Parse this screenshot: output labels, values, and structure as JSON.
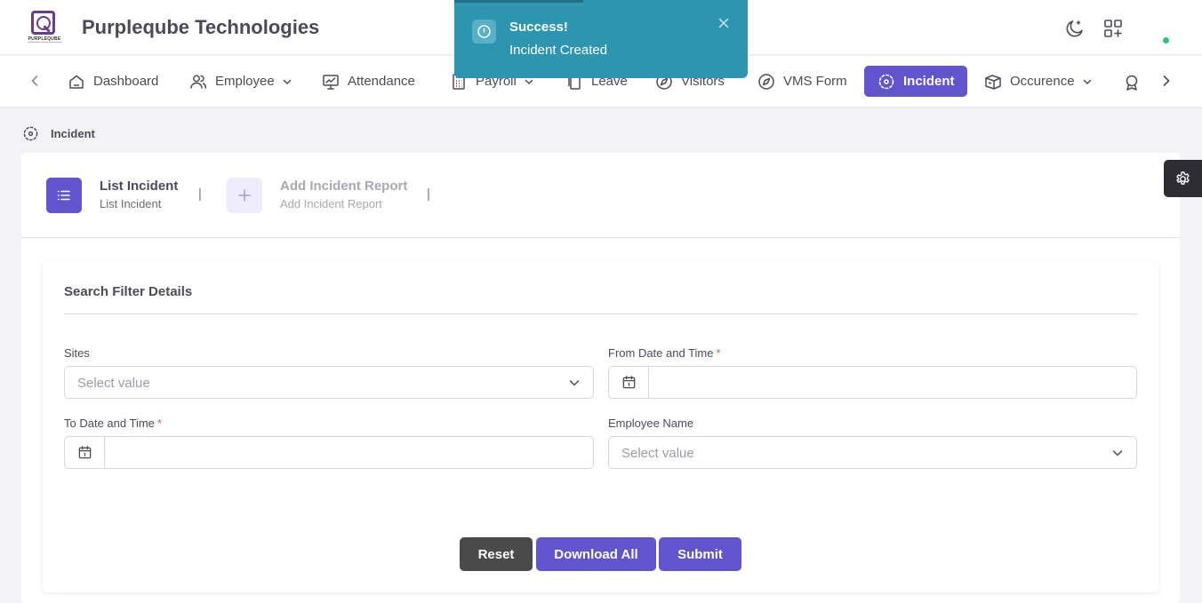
{
  "header": {
    "brand": "Purpleqube Technologies",
    "logo_text": "PURPLEQUBE",
    "icons": [
      "moon-icon",
      "apps-add-icon"
    ],
    "status_color": "#28c76f"
  },
  "nav": {
    "items": [
      {
        "label": "Dashboard",
        "icon": "home-icon"
      },
      {
        "label": "Employee",
        "icon": "users-icon",
        "dropdown": true
      },
      {
        "label": "Attendance",
        "icon": "monitor-chart-icon"
      },
      {
        "label": "Payroll",
        "icon": "calculator-icon",
        "dropdown": true
      },
      {
        "label": "Leave",
        "icon": "copy-icon"
      },
      {
        "label": "Visitors",
        "icon": "compass-icon"
      },
      {
        "label": "VMS Form",
        "icon": "compass-icon"
      },
      {
        "label": "Incident",
        "icon": "incident-icon",
        "active": true
      },
      {
        "label": "Occurence",
        "icon": "box-icon",
        "dropdown": true
      }
    ]
  },
  "toast": {
    "title": "Success!",
    "message": "Incident Created",
    "color": "#2e95b1"
  },
  "breadcrumb": {
    "label": "Incident"
  },
  "tabs": [
    {
      "title": "List Incident",
      "subtitle": "List Incident",
      "active": true
    },
    {
      "title": "Add Incident Report",
      "subtitle": "Add Incident Report",
      "active": false
    }
  ],
  "filter": {
    "title": "Search Filter Details",
    "sites": {
      "label": "Sites",
      "placeholder": "Select value"
    },
    "from_date": {
      "label": "From Date and Time",
      "required": "*",
      "value": ""
    },
    "to_date": {
      "label": "To Date and Time",
      "required": "*",
      "value": ""
    },
    "employee": {
      "label": "Employee Name",
      "placeholder": "Select value"
    }
  },
  "buttons": {
    "reset": "Reset",
    "download_all": "Download All",
    "submit": "Submit"
  },
  "colors": {
    "accent": "#6254cc",
    "dark_button": "#4a4a4a"
  }
}
